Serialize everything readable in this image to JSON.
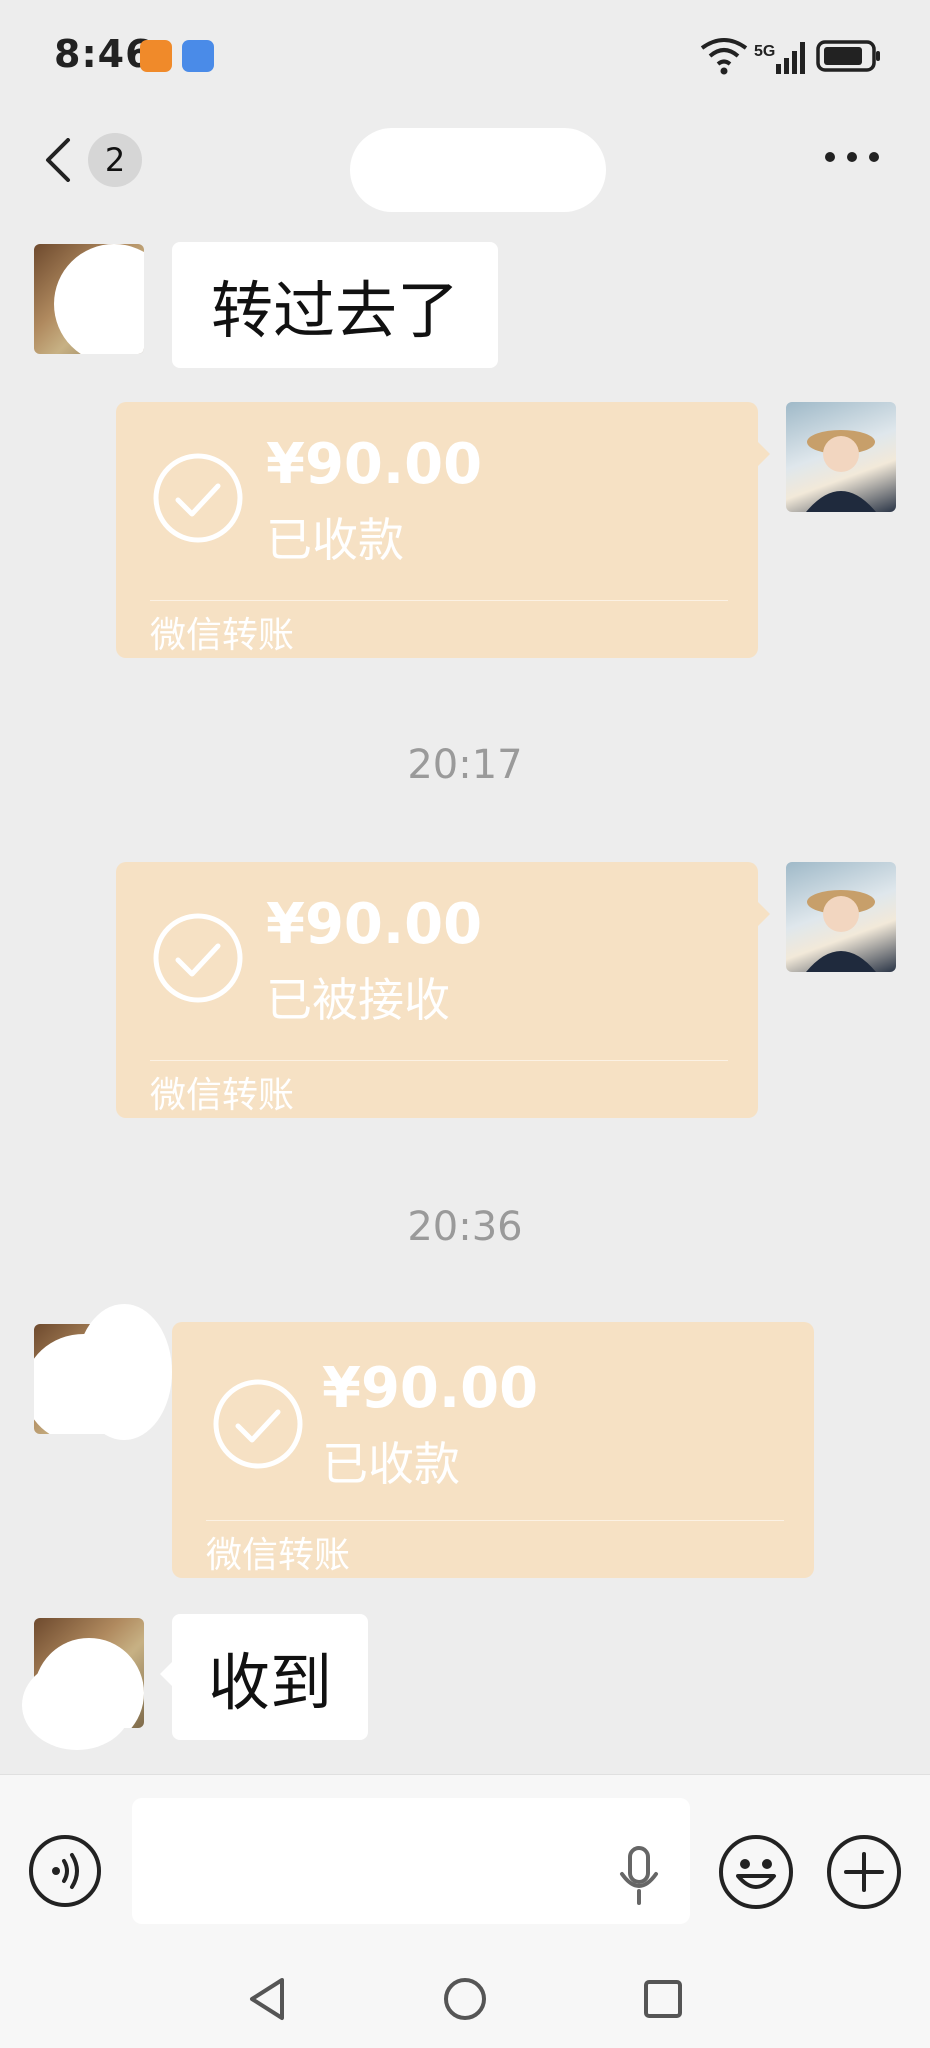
{
  "status_bar": {
    "time": "8:46",
    "network": "5G",
    "wifi_icon": "wifi-icon",
    "battery_icon": "battery-icon"
  },
  "header": {
    "back_icon": "chevron-left-icon",
    "unread_count": "2",
    "more_icon": "more-icon"
  },
  "messages": [
    {
      "type": "text",
      "side": "left",
      "text": "转过去了"
    },
    {
      "type": "transfer",
      "side": "right",
      "amount": "¥90.00",
      "status": "已收款",
      "service": "微信转账"
    },
    {
      "type": "timestamp",
      "text": "20:17"
    },
    {
      "type": "transfer",
      "side": "right",
      "amount": "¥90.00",
      "status": "已被接收",
      "service": "微信转账"
    },
    {
      "type": "timestamp",
      "text": "20:36"
    },
    {
      "type": "transfer",
      "side": "left",
      "amount": "¥90.00",
      "status": "已收款",
      "service": "微信转账"
    },
    {
      "type": "text",
      "side": "left",
      "text": "收到"
    }
  ],
  "input_bar": {
    "voice_icon": "voice-icon",
    "mic_icon": "microphone-icon",
    "emoji_icon": "emoji-icon",
    "plus_icon": "plus-icon"
  },
  "nav_bar": {
    "back_icon": "triangle-back-icon",
    "home_icon": "circle-home-icon",
    "recents_icon": "square-recents-icon"
  },
  "colors": {
    "background": "#ededed",
    "transfer_card": "#f6e1c4",
    "bubble": "#ffffff",
    "timestamp": "#9a9a9a"
  }
}
